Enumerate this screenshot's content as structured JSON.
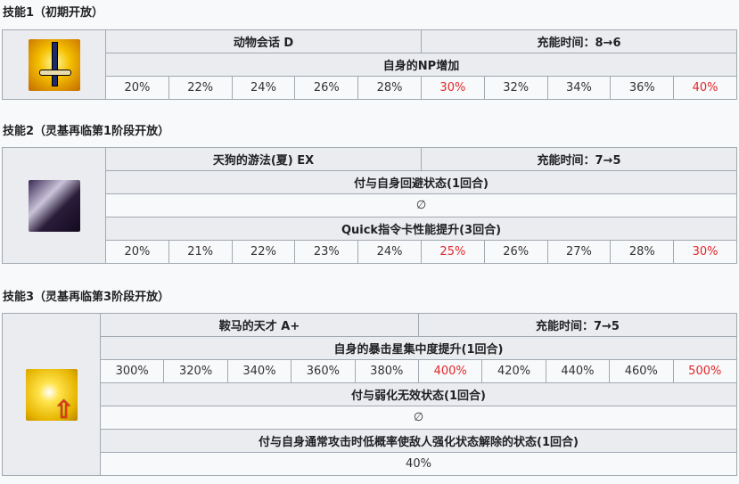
{
  "skills": [
    {
      "heading": "技能1（初期开放）",
      "icon": "sword-icon",
      "name": "动物会话 D",
      "cooldown": "充能时间：8→6",
      "effects": [
        {
          "label": "自身的NP增加",
          "values": [
            "20%",
            "22%",
            "24%",
            "26%",
            "28%",
            "30%",
            "32%",
            "34%",
            "36%",
            "40%"
          ]
        }
      ]
    },
    {
      "heading": "技能2（灵基再临第1阶段开放）",
      "icon": "evasion-icon",
      "name": "天狗的游法(夏) EX",
      "cooldown": "充能时间：7→5",
      "effects": [
        {
          "label": "付与自身回避状态(1回合)",
          "single": "∅"
        },
        {
          "label": "Quick指令卡性能提升(3回合)",
          "values": [
            "20%",
            "21%",
            "22%",
            "23%",
            "24%",
            "25%",
            "26%",
            "27%",
            "28%",
            "30%"
          ]
        }
      ]
    },
    {
      "heading": "技能3（灵基再临第3阶段开放）",
      "icon": "star-up-icon",
      "name": "鞍马的天才 A+",
      "cooldown": "充能时间：7→5",
      "effects": [
        {
          "label": "自身的暴击星集中度提升(1回合)",
          "values": [
            "300%",
            "320%",
            "340%",
            "360%",
            "380%",
            "400%",
            "420%",
            "440%",
            "460%",
            "500%"
          ]
        },
        {
          "label": "付与弱化无效状态(1回合)",
          "single": "∅"
        },
        {
          "label": "付与自身通常攻击时低概率使敌人强化状态解除的状态(1回合)",
          "single": "40%"
        }
      ]
    }
  ],
  "highlight_color": "#e0282c"
}
